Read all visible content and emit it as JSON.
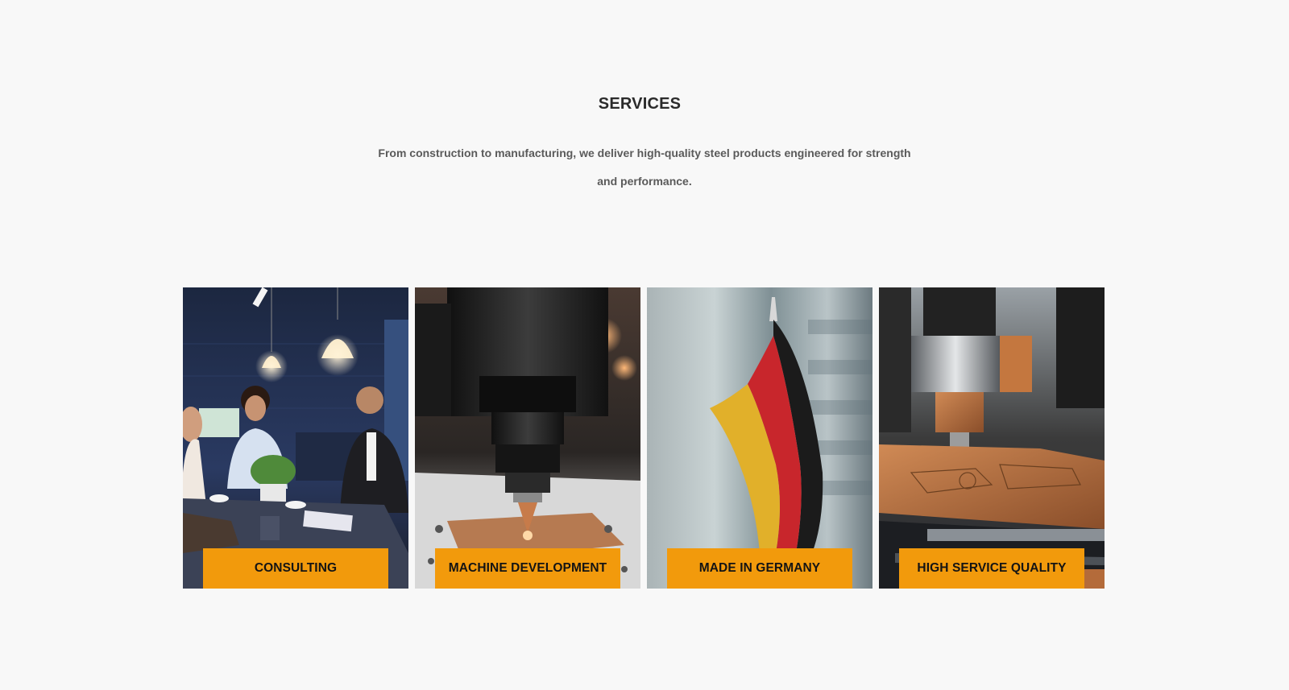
{
  "section": {
    "title": "SERVICES",
    "subtitle": "From construction to manufacturing, we deliver high-quality steel products engineered for strength and performance."
  },
  "cards": [
    {
      "label": "CONSULTING",
      "image": "business-meeting-photo"
    },
    {
      "label": "MACHINE DEVELOPMENT",
      "image": "cnc-spindle-photo"
    },
    {
      "label": "MADE IN GERMANY",
      "image": "german-flag-photo"
    },
    {
      "label": "HIGH SERVICE QUALITY",
      "image": "cnc-machining-copper-photo"
    }
  ],
  "colors": {
    "background": "#f8f8f8",
    "accent": "#f29a0c",
    "heading": "#2b2b2b",
    "subtitle": "#5a5a5a"
  }
}
